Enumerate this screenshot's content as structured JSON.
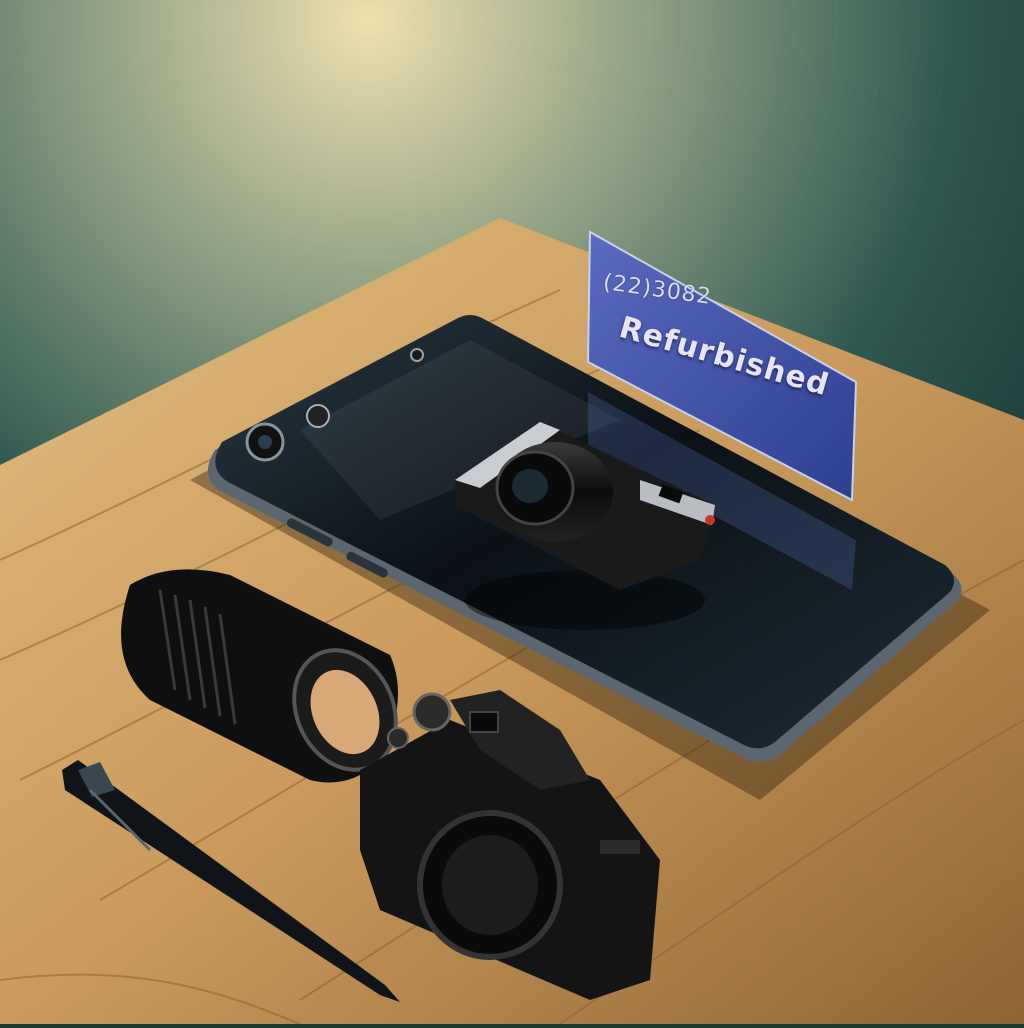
{
  "tag": {
    "code": "(22)3082",
    "label": "Refurbished"
  },
  "colors": {
    "backdrop": "#1c3a36",
    "spotlight": "#e8d7a6",
    "wood": "#c99a5c",
    "phone": "#0d1418",
    "tag": "#3d52a8"
  },
  "icons": {
    "camera": "camera-icon",
    "lens": "lens-icon",
    "pen": "pen-icon"
  }
}
